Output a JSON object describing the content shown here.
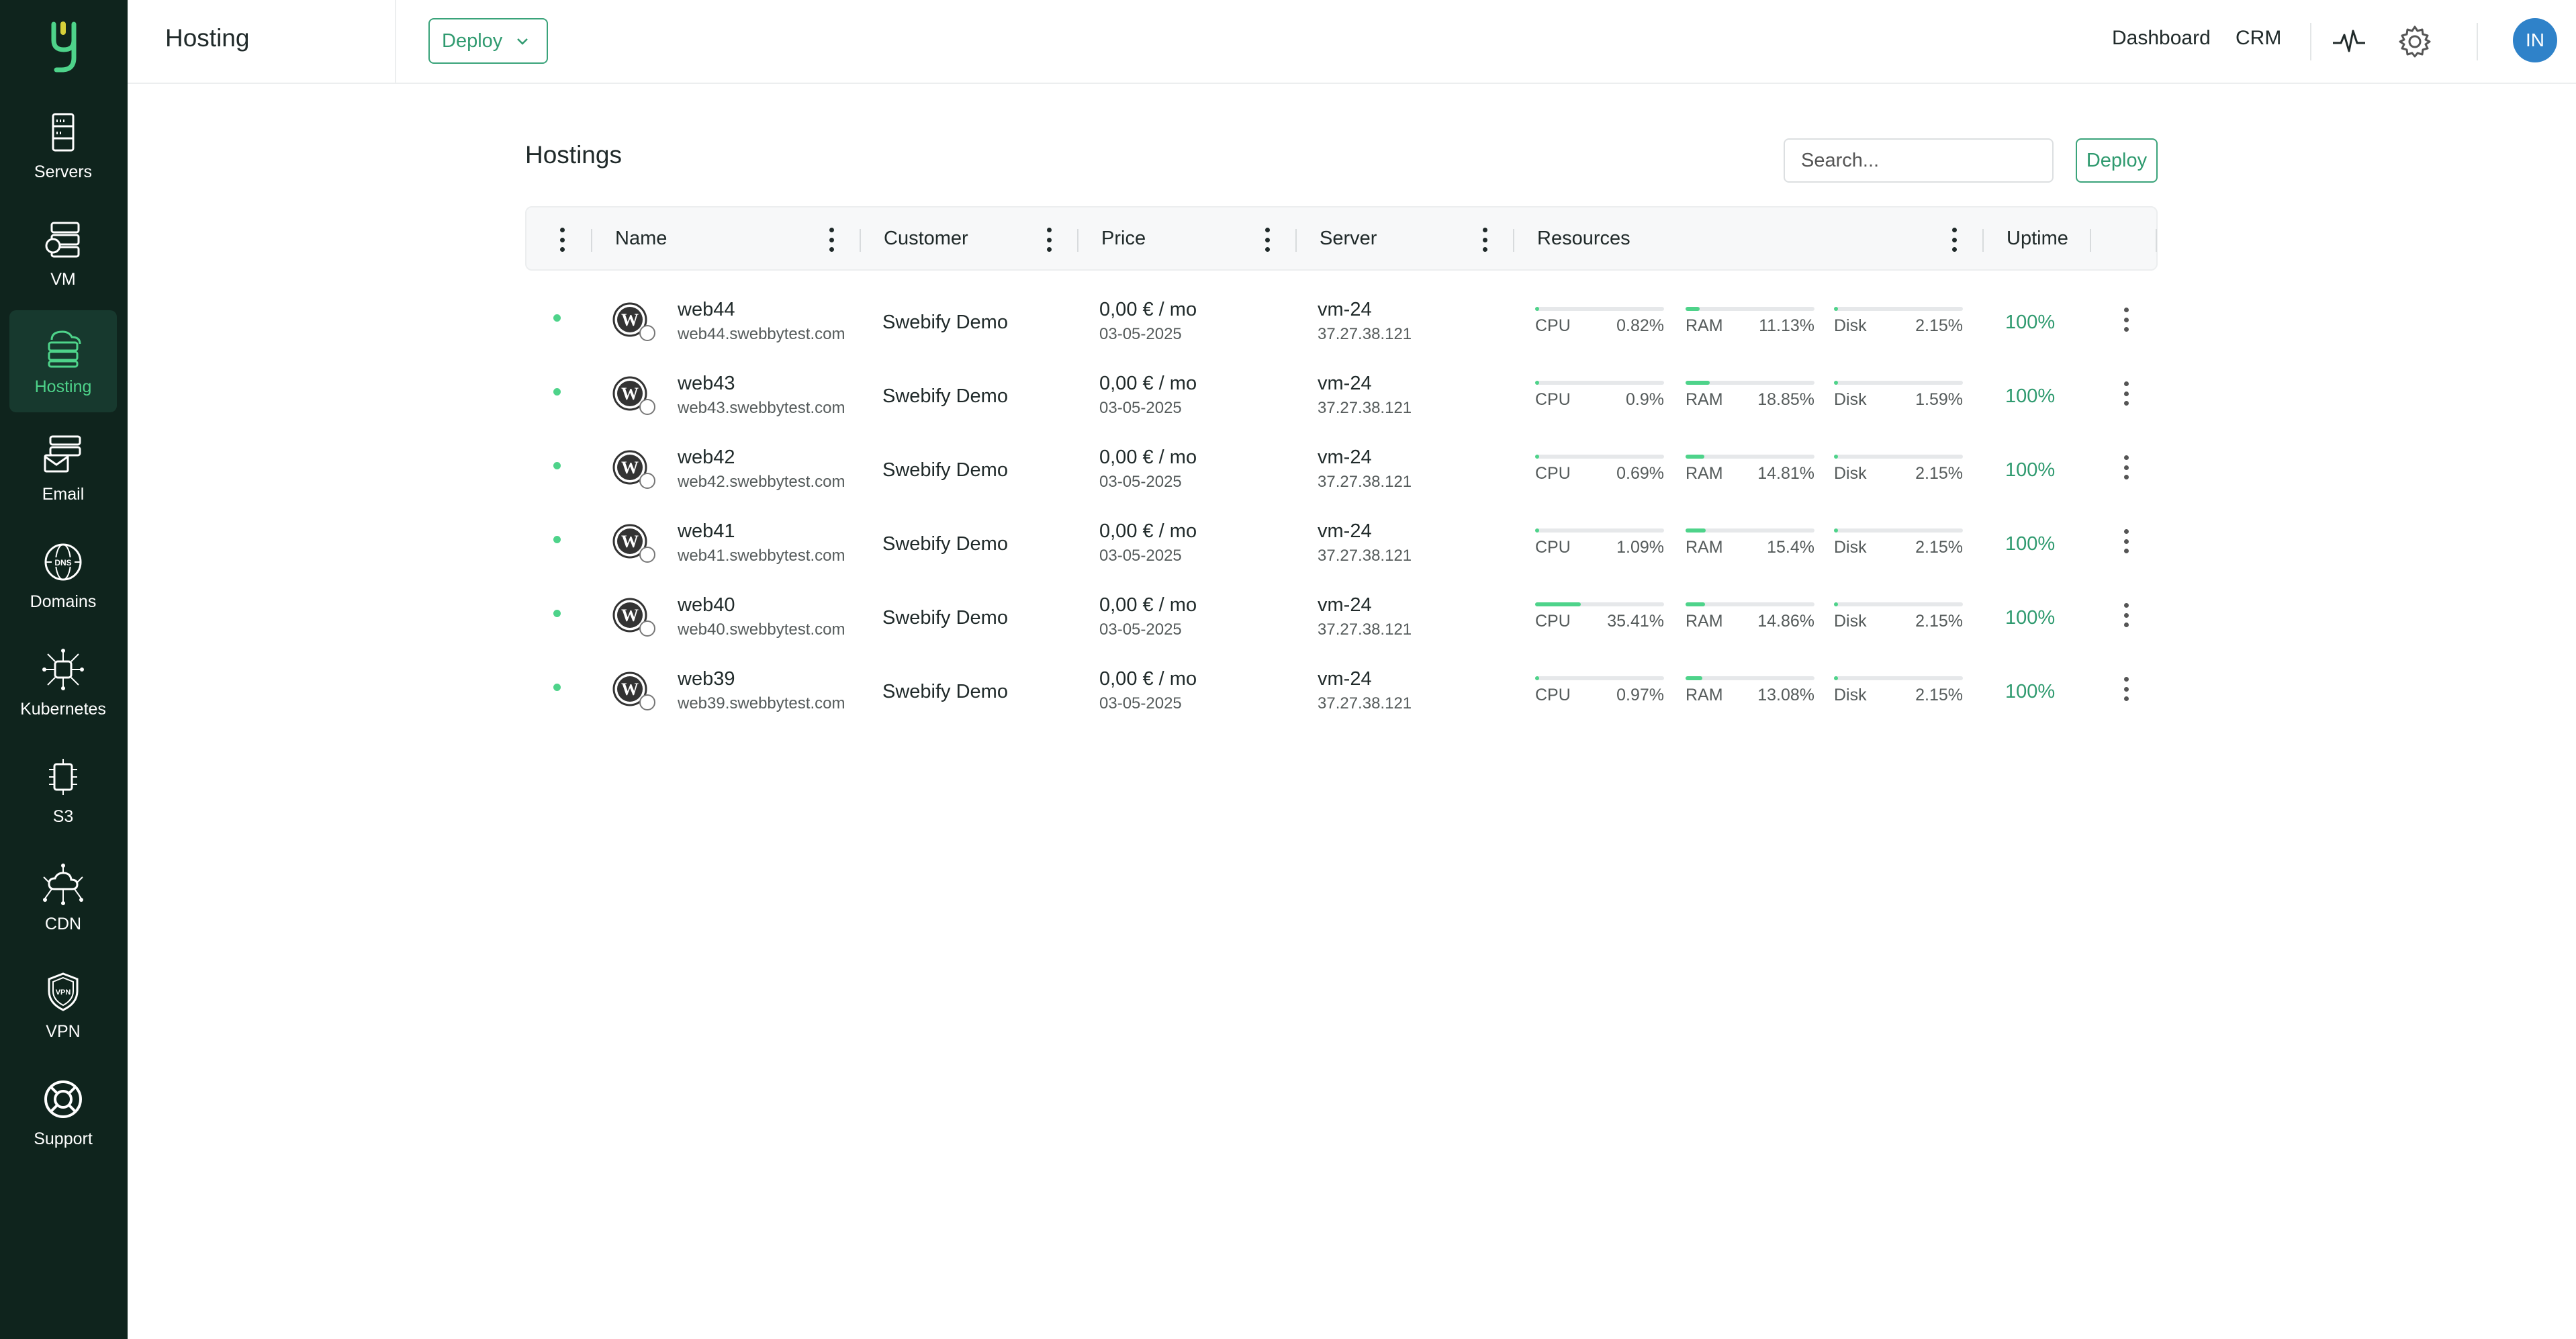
{
  "app": {
    "accent": "#4ed38a",
    "sidebar_bg": "#0f241d"
  },
  "sidebar": {
    "items": [
      {
        "label": "Servers",
        "icon": "servers-icon",
        "active": false
      },
      {
        "label": "VM",
        "icon": "vm-icon",
        "active": false
      },
      {
        "label": "Hosting",
        "icon": "hosting-icon",
        "active": true
      },
      {
        "label": "Email",
        "icon": "email-icon",
        "active": false
      },
      {
        "label": "Domains",
        "icon": "dns-globe-icon",
        "active": false
      },
      {
        "label": "Kubernetes",
        "icon": "kubernetes-icon",
        "active": false
      },
      {
        "label": "S3",
        "icon": "s3-icon",
        "active": false
      },
      {
        "label": "CDN",
        "icon": "cdn-icon",
        "active": false
      },
      {
        "label": "VPN",
        "icon": "vpn-shield-icon",
        "active": false
      },
      {
        "label": "Support",
        "icon": "lifebuoy-icon",
        "active": false
      }
    ]
  },
  "header": {
    "title": "Hosting",
    "deploy_label": "Deploy",
    "links": {
      "dashboard": "Dashboard",
      "crm": "CRM"
    },
    "avatar": "IN"
  },
  "main": {
    "title": "Hostings",
    "search_placeholder": "Search...",
    "deploy_label": "Deploy",
    "columns": {
      "name": "Name",
      "customer": "Customer",
      "price": "Price",
      "server": "Server",
      "resources": "Resources",
      "uptime": "Uptime"
    },
    "rows": [
      {
        "name": "web44",
        "domain": "web44.swebbytest.com",
        "customer": "Swebify Demo",
        "price": "0,00 € / mo",
        "date": "03-05-2025",
        "server": "vm-24",
        "ip": "37.27.38.121",
        "cpu": "0.82%",
        "ram": "11.13%",
        "disk": "2.15%",
        "cpu_v": 0.82,
        "ram_v": 11.13,
        "disk_v": 2.15,
        "uptime": "100%"
      },
      {
        "name": "web43",
        "domain": "web43.swebbytest.com",
        "customer": "Swebify Demo",
        "price": "0,00 € / mo",
        "date": "03-05-2025",
        "server": "vm-24",
        "ip": "37.27.38.121",
        "cpu": "0.9%",
        "ram": "18.85%",
        "disk": "1.59%",
        "cpu_v": 0.9,
        "ram_v": 18.85,
        "disk_v": 1.59,
        "uptime": "100%"
      },
      {
        "name": "web42",
        "domain": "web42.swebbytest.com",
        "customer": "Swebify Demo",
        "price": "0,00 € / mo",
        "date": "03-05-2025",
        "server": "vm-24",
        "ip": "37.27.38.121",
        "cpu": "0.69%",
        "ram": "14.81%",
        "disk": "2.15%",
        "cpu_v": 0.69,
        "ram_v": 14.81,
        "disk_v": 2.15,
        "uptime": "100%"
      },
      {
        "name": "web41",
        "domain": "web41.swebbytest.com",
        "customer": "Swebify Demo",
        "price": "0,00 € / mo",
        "date": "03-05-2025",
        "server": "vm-24",
        "ip": "37.27.38.121",
        "cpu": "1.09%",
        "ram": "15.4%",
        "disk": "2.15%",
        "cpu_v": 1.09,
        "ram_v": 15.4,
        "disk_v": 2.15,
        "uptime": "100%"
      },
      {
        "name": "web40",
        "domain": "web40.swebbytest.com",
        "customer": "Swebify Demo",
        "price": "0,00 € / mo",
        "date": "03-05-2025",
        "server": "vm-24",
        "ip": "37.27.38.121",
        "cpu": "35.41%",
        "ram": "14.86%",
        "disk": "2.15%",
        "cpu_v": 35.41,
        "ram_v": 14.86,
        "disk_v": 2.15,
        "uptime": "100%"
      },
      {
        "name": "web39",
        "domain": "web39.swebbytest.com",
        "customer": "Swebify Demo",
        "price": "0,00 € / mo",
        "date": "03-05-2025",
        "server": "vm-24",
        "ip": "37.27.38.121",
        "cpu": "0.97%",
        "ram": "13.08%",
        "disk": "2.15%",
        "cpu_v": 0.97,
        "ram_v": 13.08,
        "disk_v": 2.15,
        "uptime": "100%"
      }
    ],
    "resource_labels": {
      "cpu": "CPU",
      "ram": "RAM",
      "disk": "Disk"
    }
  }
}
